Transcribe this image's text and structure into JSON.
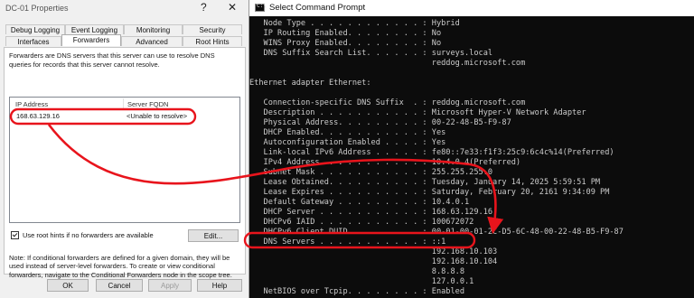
{
  "dialog": {
    "title": "DC-01 Properties",
    "help_glyph": "?",
    "close_glyph": "✕",
    "tabs_row1": [
      "Debug Logging",
      "Event Logging",
      "Monitoring",
      "Security"
    ],
    "tabs_row2": [
      "Interfaces",
      "Forwarders",
      "Advanced",
      "Root Hints"
    ],
    "active_tab": "Forwarders",
    "description": "Forwarders are DNS servers that this server can use to resolve DNS queries for records that this server cannot resolve.",
    "list_headers": {
      "ip": "IP Address",
      "fqdn": "Server FQDN"
    },
    "rows": [
      {
        "ip": "168.63.129.16",
        "fqdn": "<Unable to resolve>"
      }
    ],
    "checkbox_label": "Use root hints if no forwarders are available",
    "checkbox_checked": true,
    "edit_button": "Edit...",
    "note": "Note: If conditional forwarders are defined for a given domain, they will be used instead of server-level forwarders. To create or view conditional forwarders, navigate to the Conditional Forwarders node in the scope tree.",
    "buttons": {
      "ok": "OK",
      "cancel": "Cancel",
      "apply": "Apply",
      "help": "Help"
    }
  },
  "cmd": {
    "title": "Select Command Prompt",
    "icon_text": "C:\\",
    "lines": [
      "   Node Type . . . . . . . . . . . . : Hybrid",
      "   IP Routing Enabled. . . . . . . . : No",
      "   WINS Proxy Enabled. . . . . . . . : No",
      "   DNS Suffix Search List. . . . . . : surveys.local",
      "                                       reddog.microsoft.com",
      "",
      "Ethernet adapter Ethernet:",
      "",
      "   Connection-specific DNS Suffix  . : reddog.microsoft.com",
      "   Description . . . . . . . . . . . : Microsoft Hyper-V Network Adapter",
      "   Physical Address. . . . . . . . . : 00-22-48-B5-F9-87",
      "   DHCP Enabled. . . . . . . . . . . : Yes",
      "   Autoconfiguration Enabled . . . . : Yes",
      "   Link-local IPv6 Address . . . . . : fe80::7e33:f1f3:25c9:6c4c%14(Preferred)",
      "   IPv4 Address. . . . . . . . . . . : 10.4.0.4(Preferred)",
      "   Subnet Mask . . . . . . . . . . . : 255.255.255.0",
      "   Lease Obtained. . . . . . . . . . : Tuesday, January 14, 2025 5:59:51 PM",
      "   Lease Expires . . . . . . . . . . : Saturday, February 20, 2161 9:34:09 PM",
      "   Default Gateway . . . . . . . . . : 10.4.0.1",
      "   DHCP Server . . . . . . . . . . . : 168.63.129.16",
      "   DHCPv6 IAID . . . . . . . . . . . : 100672072",
      "   DHCPv6 Client DUID. . . . . . . . : 00-01-00-01-2C-D5-6C-48-00-22-48-B5-F9-87",
      "   DNS Servers . . . . . . . . . . . : ::1",
      "                                       192.168.10.103",
      "                                       192.168.10.104",
      "                                       8.8.8.8",
      "                                       127.0.0.1",
      "   NetBIOS over Tcpip. . . . . . . . : Enabled"
    ]
  },
  "annotation_color": "#e8141c"
}
